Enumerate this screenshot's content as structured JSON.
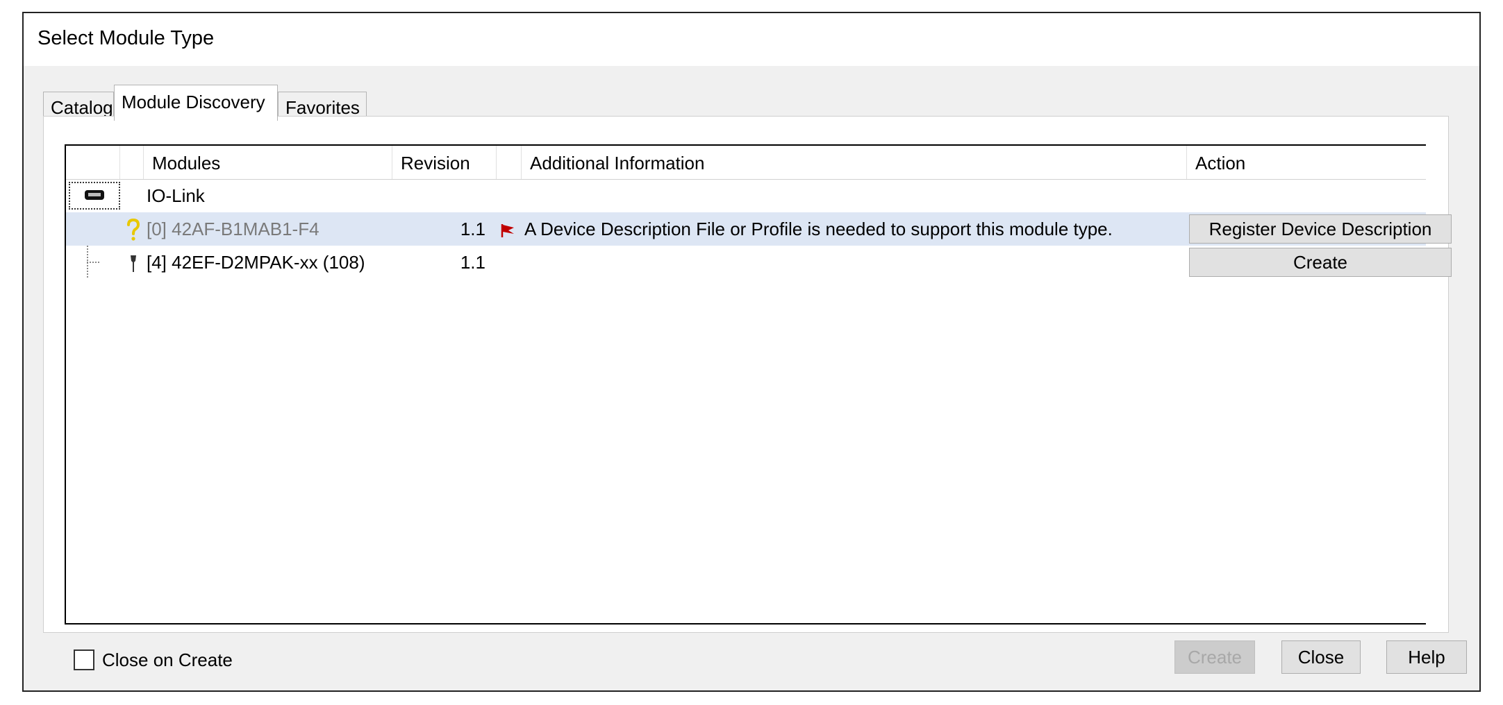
{
  "window": {
    "title": "Select Module Type"
  },
  "tabs": [
    {
      "label": "Catalog"
    },
    {
      "label": "Module Discovery"
    },
    {
      "label": "Favorites"
    }
  ],
  "grid": {
    "columns": [
      "Modules",
      "Revision",
      "Additional Information",
      "Action"
    ],
    "group": {
      "label": "IO-Link",
      "icon": "io-link-port-icon"
    },
    "rows": [
      {
        "module": "[0] 42AF-B1MAB1-F4",
        "revision": "1.1",
        "status_icon": "question-mark-icon",
        "info_icon": "red-flag-icon",
        "info": "A Device Description File or Profile is needed to support this module type.",
        "action": "Register Device Description",
        "selected": true
      },
      {
        "module": "[4] 42EF-D2MPAK-xx (108)",
        "revision": "1.1",
        "status_icon": "sensor-icon",
        "info": "",
        "action": "Create",
        "selected": false
      }
    ]
  },
  "footer": {
    "close_on_create_label": "Close on Create",
    "close_on_create_checked": false,
    "create_label": "Create",
    "close_label": "Close",
    "help_label": "Help"
  },
  "colors": {
    "selected_row": "#dde6f4",
    "flag": "#c00000",
    "question": "#e8c800"
  }
}
